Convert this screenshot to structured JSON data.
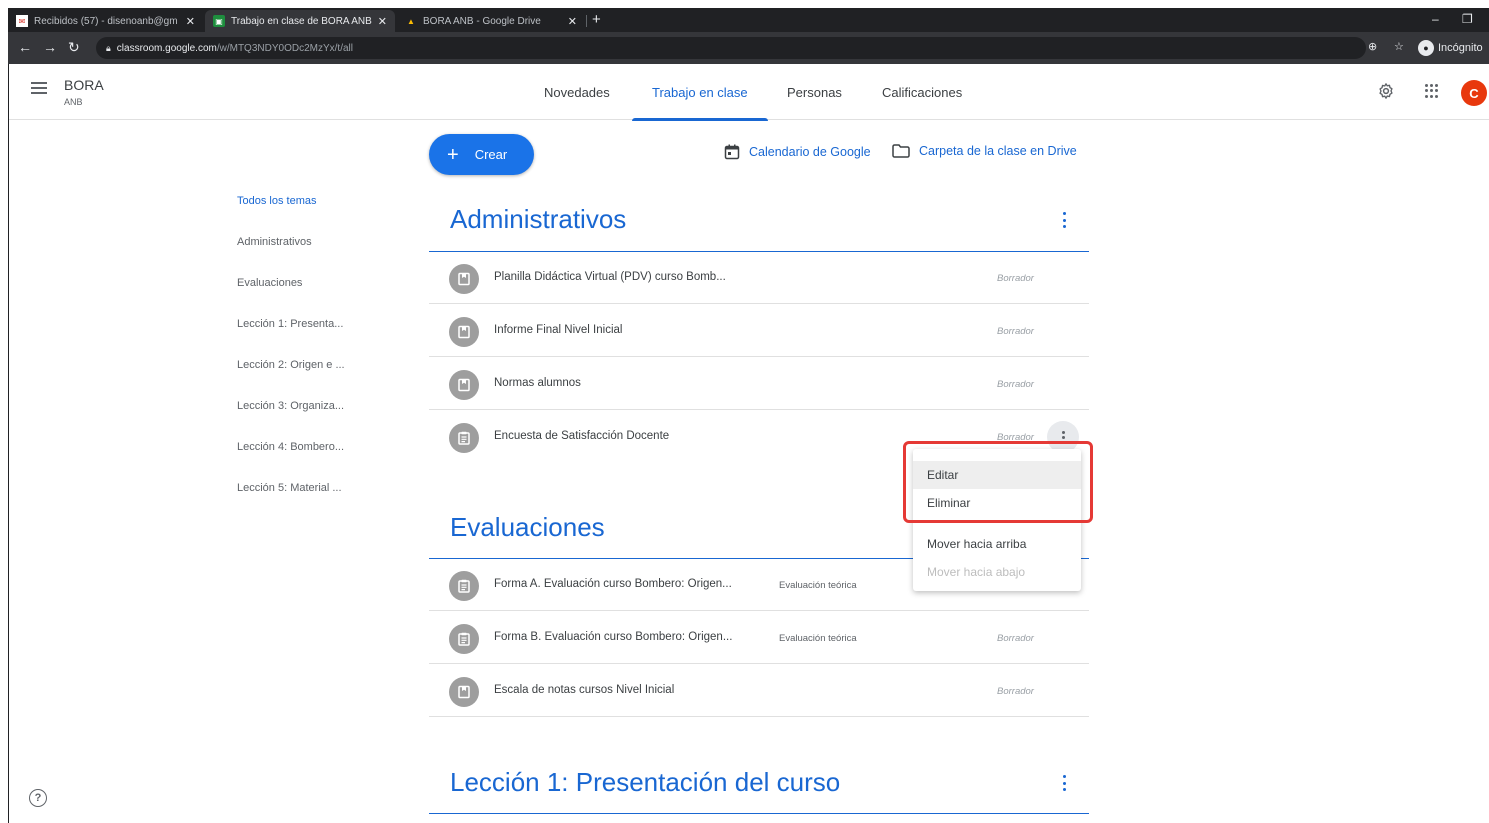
{
  "browser": {
    "tabs": [
      {
        "title": "Recibidos (57) - disenoanb@gm",
        "active": false
      },
      {
        "title": "Trabajo en clase de BORA ANB",
        "active": true
      },
      {
        "title": "BORA ANB - Google Drive",
        "active": false
      }
    ],
    "url_host": "classroom.google.com",
    "url_path": "/w/MTQ3NDY0ODc2MzYx/t/all",
    "incognito_label": "Incógnito"
  },
  "app": {
    "class_name": "BORA",
    "class_section": "ANB",
    "nav": [
      "Novedades",
      "Trabajo en clase",
      "Personas",
      "Calificaciones"
    ],
    "active_nav": "Trabajo en clase",
    "avatar_letter": "C",
    "avatar_color": "#e8380d"
  },
  "toolbar": {
    "create_label": "Crear",
    "calendar_label": "Calendario de Google",
    "drive_label": "Carpeta de la clase en Drive"
  },
  "topics": [
    "Todos los temas",
    "Administrativos",
    "Evaluaciones",
    "Lección 1: Presenta...",
    "Lección 2: Origen e ...",
    "Lección 3: Organiza...",
    "Lección 4: Bombero...",
    "Lección 5: Material ..."
  ],
  "sections": [
    {
      "title": "Administrativos",
      "items": [
        {
          "title": "Planilla Didáctica Virtual (PDV) curso Bomb...",
          "topic": "",
          "status": "Borrador",
          "icon": "material-icon"
        },
        {
          "title": "Informe Final Nivel Inicial",
          "topic": "",
          "status": "Borrador",
          "icon": "material-icon"
        },
        {
          "title": "Normas alumnos",
          "topic": "",
          "status": "Borrador",
          "icon": "material-icon"
        },
        {
          "title": "Encuesta de Satisfacción Docente",
          "topic": "",
          "status": "Borrador",
          "icon": "assignment-icon"
        }
      ]
    },
    {
      "title": "Evaluaciones",
      "items": [
        {
          "title": "Forma A. Evaluación curso Bombero: Origen...",
          "topic": "Evaluación teórica",
          "status": "",
          "icon": "assignment-icon"
        },
        {
          "title": "Forma B. Evaluación curso Bombero: Origen...",
          "topic": "Evaluación teórica",
          "status": "Borrador",
          "icon": "assignment-icon"
        },
        {
          "title": "Escala de notas cursos Nivel Inicial",
          "topic": "",
          "status": "Borrador",
          "icon": "material-icon"
        }
      ]
    },
    {
      "title": "Lección 1: Presentación del curso",
      "items": []
    }
  ],
  "context_menu": [
    "Editar",
    "Eliminar",
    "Mover hacia arriba",
    "Mover hacia abajo"
  ],
  "colors": {
    "accent": "#1967d2",
    "button": "#1a73e8",
    "highlight": "#e53935"
  }
}
